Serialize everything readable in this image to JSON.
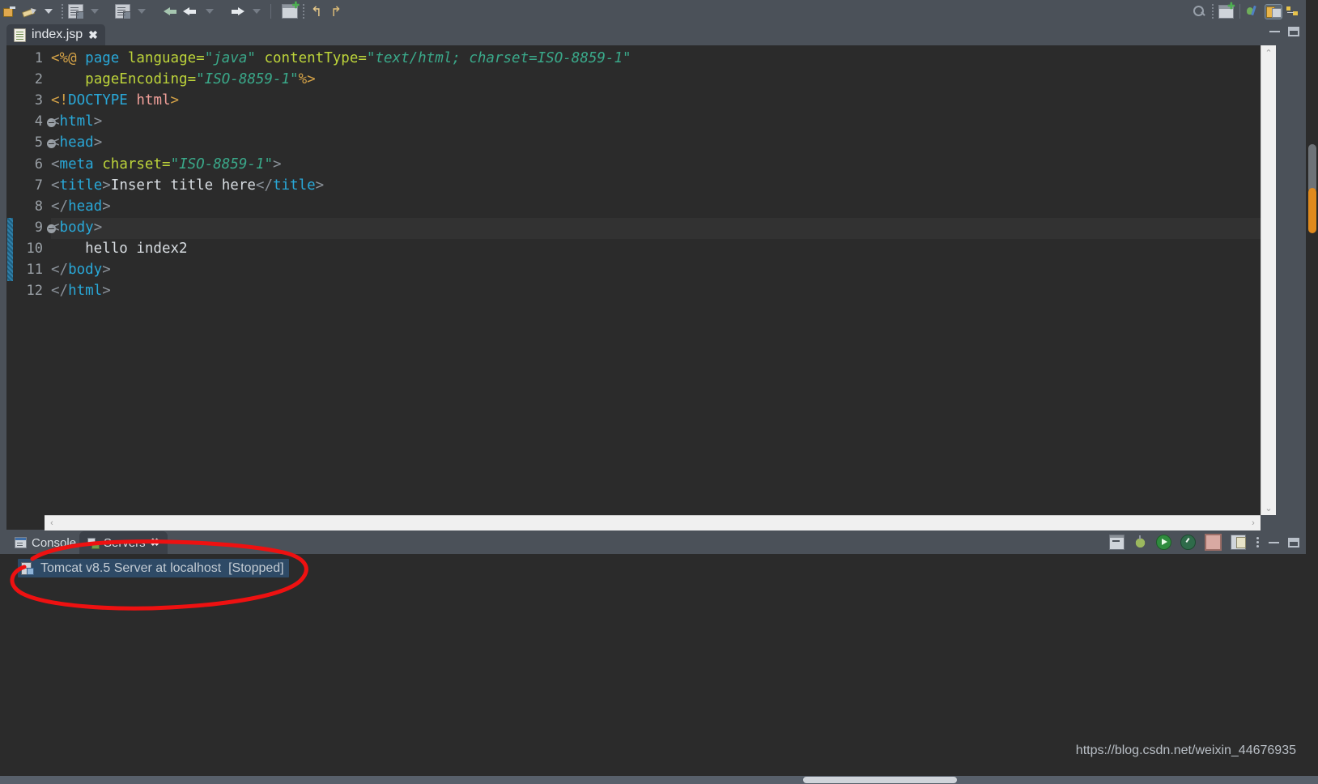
{
  "toolbar": {
    "left_icons": [
      {
        "name": "quick-access-icon",
        "label": "Quick Access"
      },
      {
        "name": "pen-edit-icon",
        "label": "Edit"
      },
      {
        "name": "dropdown-caret-icon",
        "label": "Open menu"
      },
      {
        "name": "export-icon",
        "label": "Export"
      },
      {
        "name": "export-dropdown-icon",
        "label": "Export options"
      },
      {
        "name": "import-icon",
        "label": "Import"
      },
      {
        "name": "import-dropdown-icon",
        "label": "Import options"
      },
      {
        "name": "back-green-icon",
        "label": "Back"
      },
      {
        "name": "back-icon",
        "label": "Back"
      },
      {
        "name": "back-dropdown-icon",
        "label": "Back history"
      },
      {
        "name": "forward-icon",
        "label": "Forward"
      },
      {
        "name": "forward-dropdown-icon",
        "label": "Forward history"
      },
      {
        "name": "new-window-icon",
        "label": "New Window"
      },
      {
        "name": "undo-icon",
        "label": "Undo"
      },
      {
        "name": "redo-icon",
        "label": "Redo"
      }
    ],
    "right_icons": [
      {
        "name": "search-icon",
        "label": "Search"
      },
      {
        "name": "open-perspective-icon",
        "label": "Open Perspective"
      },
      {
        "name": "perspective-debug-icon",
        "label": "Debug"
      },
      {
        "name": "perspective-java-ee-icon",
        "label": "Java EE"
      },
      {
        "name": "perspective-java-icon",
        "label": "Java"
      }
    ]
  },
  "editor_tab": {
    "title": "index.jsp",
    "close_label": "✖",
    "icon": "jsp-file-icon",
    "minimize_label": "Minimize",
    "maximize_label": "Maximize"
  },
  "editor": {
    "current_line": 9,
    "change_bar_lines": [
      9,
      10,
      11
    ],
    "fold_lines": [
      4,
      5,
      9
    ],
    "line_numbers": [
      "1",
      "2",
      "3",
      "4",
      "5",
      "6",
      "7",
      "8",
      "9",
      "10",
      "11",
      "12"
    ],
    "lines": [
      {
        "n": "1",
        "tokens": [
          {
            "t": "<%@",
            "c": "c-punct"
          },
          {
            "t": " ",
            "c": "c-text"
          },
          {
            "t": "page",
            "c": "c-tag"
          },
          {
            "t": " ",
            "c": "c-text"
          },
          {
            "t": "language",
            "c": "c-attr"
          },
          {
            "t": "=",
            "c": "c-attr"
          },
          {
            "t": "\"java\"",
            "c": "c-str"
          },
          {
            "t": " ",
            "c": "c-text"
          },
          {
            "t": "contentType",
            "c": "c-attr"
          },
          {
            "t": "=",
            "c": "c-attr"
          },
          {
            "t": "\"text/html; charset=ISO-8859-1\"",
            "c": "c-str"
          }
        ]
      },
      {
        "n": "2",
        "tokens": [
          {
            "t": "    ",
            "c": "c-text"
          },
          {
            "t": "pageEncoding",
            "c": "c-attr"
          },
          {
            "t": "=",
            "c": "c-attr"
          },
          {
            "t": "\"ISO-8859-1\"",
            "c": "c-str"
          },
          {
            "t": "%>",
            "c": "c-punct"
          }
        ]
      },
      {
        "n": "3",
        "tokens": [
          {
            "t": "<!",
            "c": "c-punct"
          },
          {
            "t": "DOCTYPE",
            "c": "c-tag"
          },
          {
            "t": " ",
            "c": "c-text"
          },
          {
            "t": "html",
            "c": "c-doctype"
          },
          {
            "t": ">",
            "c": "c-punct"
          }
        ]
      },
      {
        "n": "4",
        "tokens": [
          {
            "t": "<",
            "c": "c-angle"
          },
          {
            "t": "html",
            "c": "c-tag"
          },
          {
            "t": ">",
            "c": "c-angle"
          }
        ]
      },
      {
        "n": "5",
        "tokens": [
          {
            "t": "<",
            "c": "c-angle"
          },
          {
            "t": "head",
            "c": "c-tag"
          },
          {
            "t": ">",
            "c": "c-angle"
          }
        ]
      },
      {
        "n": "6",
        "tokens": [
          {
            "t": "<",
            "c": "c-angle"
          },
          {
            "t": "meta",
            "c": "c-tag"
          },
          {
            "t": " ",
            "c": "c-text"
          },
          {
            "t": "charset",
            "c": "c-attr"
          },
          {
            "t": "=",
            "c": "c-attr"
          },
          {
            "t": "\"ISO-8859-1\"",
            "c": "c-str"
          },
          {
            "t": ">",
            "c": "c-angle"
          }
        ]
      },
      {
        "n": "7",
        "tokens": [
          {
            "t": "<",
            "c": "c-angle"
          },
          {
            "t": "title",
            "c": "c-tag"
          },
          {
            "t": ">",
            "c": "c-angle"
          },
          {
            "t": "Insert title here",
            "c": "c-text"
          },
          {
            "t": "</",
            "c": "c-angle"
          },
          {
            "t": "title",
            "c": "c-tag"
          },
          {
            "t": ">",
            "c": "c-angle"
          }
        ]
      },
      {
        "n": "8",
        "tokens": [
          {
            "t": "</",
            "c": "c-angle"
          },
          {
            "t": "head",
            "c": "c-tag"
          },
          {
            "t": ">",
            "c": "c-angle"
          }
        ]
      },
      {
        "n": "9",
        "tokens": [
          {
            "t": "<",
            "c": "c-angle"
          },
          {
            "t": "body",
            "c": "c-tag"
          },
          {
            "t": ">",
            "c": "c-angle"
          }
        ]
      },
      {
        "n": "10",
        "tokens": [
          {
            "t": "    hello index2",
            "c": "c-text"
          }
        ]
      },
      {
        "n": "11",
        "tokens": [
          {
            "t": "</",
            "c": "c-angle"
          },
          {
            "t": "body",
            "c": "c-tag"
          },
          {
            "t": ">",
            "c": "c-angle"
          }
        ]
      },
      {
        "n": "12",
        "tokens": [
          {
            "t": "</",
            "c": "c-angle"
          },
          {
            "t": "html",
            "c": "c-tag"
          },
          {
            "t": ">",
            "c": "c-angle"
          }
        ]
      }
    ],
    "vscroll_up": "⌃",
    "vscroll_down": "⌄",
    "hscroll_left": "‹",
    "hscroll_right": "›"
  },
  "bottom_panel": {
    "tabs": [
      {
        "label": "Console",
        "icon": "console-icon",
        "active": false
      },
      {
        "label": "Servers",
        "icon": "servers-icon",
        "active": true,
        "close_label": "✖"
      }
    ],
    "toolbar_icons": [
      {
        "name": "new-server-icon",
        "label": "New Server"
      },
      {
        "name": "debug-icon",
        "label": "Debug"
      },
      {
        "name": "start-server-icon",
        "label": "Start"
      },
      {
        "name": "profile-server-icon",
        "label": "Profile"
      },
      {
        "name": "stop-server-icon",
        "label": "Stop"
      },
      {
        "name": "publish-icon",
        "label": "Publish"
      },
      {
        "name": "view-menu-icon",
        "label": "View Menu"
      },
      {
        "name": "minimize-icon",
        "label": "Minimize"
      },
      {
        "name": "maximize-icon",
        "label": "Maximize"
      }
    ],
    "server": {
      "name": "Tomcat v8.5 Server at localhost",
      "status": "[Stopped]",
      "full_label": "Tomcat v8.5 Server at localhost  [Stopped]",
      "icon": "tomcat-server-icon",
      "selected": true
    }
  },
  "annotation": {
    "type": "hand-drawn-ellipse",
    "color": "#ee1111",
    "target": "Tomcat v8.5 Server at localhost  [Stopped]"
  },
  "watermark": {
    "text": "https://blog.csdn.net/weixin_44676935"
  },
  "colors": {
    "window_chrome": "#4b5159",
    "editor_background": "#2b2b2b",
    "current_line": "#323232",
    "selection_blue": "#2e4a66",
    "accent_orange": "#e08a1e",
    "annotation_red": "#ee1111",
    "tag_blue": "#29a8d8",
    "attribute_green": "#bdd43a",
    "string_teal": "#3aa98a",
    "jsp_punct_gold": "#d4a247",
    "doctype_pink": "#f1a09a",
    "change_bar_teal": "#2f7fa8"
  }
}
